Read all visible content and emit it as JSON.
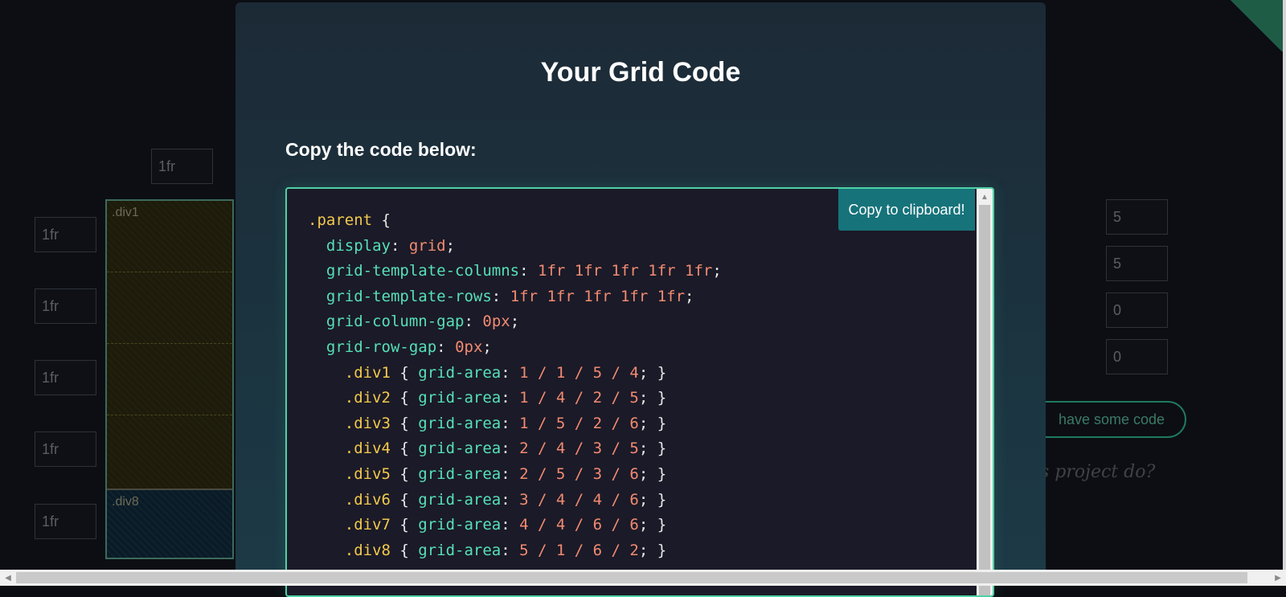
{
  "background": {
    "column_inputs": [
      "1fr"
    ],
    "row_inputs": [
      "1fr",
      "1fr",
      "1fr",
      "1fr",
      "1fr"
    ],
    "settings_inputs": [
      "5",
      "5",
      "0",
      "0"
    ],
    "grid_labels": [
      ".div1",
      ".div8"
    ],
    "code_button_label": "have some code",
    "question_text": "s project do?"
  },
  "modal": {
    "title": "Your Grid Code",
    "subtitle": "Copy the code below:",
    "copy_button_label": "Copy to clipboard!",
    "code_lines": [
      [
        [
          ".parent",
          "sel"
        ],
        [
          " {",
          "punc"
        ]
      ],
      [
        [
          "  ",
          "punc"
        ],
        [
          "display",
          "prop"
        ],
        [
          ": ",
          "punc"
        ],
        [
          "grid",
          "val"
        ],
        [
          ";",
          "punc"
        ]
      ],
      [
        [
          "  ",
          "punc"
        ],
        [
          "grid-template-columns",
          "prop"
        ],
        [
          ": ",
          "punc"
        ],
        [
          "1fr 1fr 1fr 1fr 1fr",
          "val"
        ],
        [
          ";",
          "punc"
        ]
      ],
      [
        [
          "  ",
          "punc"
        ],
        [
          "grid-template-rows",
          "prop"
        ],
        [
          ": ",
          "punc"
        ],
        [
          "1fr 1fr 1fr 1fr 1fr",
          "val"
        ],
        [
          ";",
          "punc"
        ]
      ],
      [
        [
          "  ",
          "punc"
        ],
        [
          "grid-column-gap",
          "prop"
        ],
        [
          ": ",
          "punc"
        ],
        [
          "0px",
          "val"
        ],
        [
          ";",
          "punc"
        ]
      ],
      [
        [
          "  ",
          "punc"
        ],
        [
          "grid-row-gap",
          "prop"
        ],
        [
          ": ",
          "punc"
        ],
        [
          "0px",
          "val"
        ],
        [
          ";",
          "punc"
        ]
      ],
      [
        [
          "    ",
          "punc"
        ],
        [
          ".div1",
          "sel"
        ],
        [
          " { ",
          "punc"
        ],
        [
          "grid-area",
          "prop"
        ],
        [
          ": ",
          "punc"
        ],
        [
          "1 / 1 / 5 / 4",
          "val"
        ],
        [
          "; }",
          "punc"
        ]
      ],
      [
        [
          "    ",
          "punc"
        ],
        [
          ".div2",
          "sel"
        ],
        [
          " { ",
          "punc"
        ],
        [
          "grid-area",
          "prop"
        ],
        [
          ": ",
          "punc"
        ],
        [
          "1 / 4 / 2 / 5",
          "val"
        ],
        [
          "; }",
          "punc"
        ]
      ],
      [
        [
          "    ",
          "punc"
        ],
        [
          ".div3",
          "sel"
        ],
        [
          " { ",
          "punc"
        ],
        [
          "grid-area",
          "prop"
        ],
        [
          ": ",
          "punc"
        ],
        [
          "1 / 5 / 2 / 6",
          "val"
        ],
        [
          "; }",
          "punc"
        ]
      ],
      [
        [
          "    ",
          "punc"
        ],
        [
          ".div4",
          "sel"
        ],
        [
          " { ",
          "punc"
        ],
        [
          "grid-area",
          "prop"
        ],
        [
          ": ",
          "punc"
        ],
        [
          "2 / 4 / 3 / 5",
          "val"
        ],
        [
          "; }",
          "punc"
        ]
      ],
      [
        [
          "    ",
          "punc"
        ],
        [
          ".div5",
          "sel"
        ],
        [
          " { ",
          "punc"
        ],
        [
          "grid-area",
          "prop"
        ],
        [
          ": ",
          "punc"
        ],
        [
          "2 / 5 / 3 / 6",
          "val"
        ],
        [
          "; }",
          "punc"
        ]
      ],
      [
        [
          "    ",
          "punc"
        ],
        [
          ".div6",
          "sel"
        ],
        [
          " { ",
          "punc"
        ],
        [
          "grid-area",
          "prop"
        ],
        [
          ": ",
          "punc"
        ],
        [
          "3 / 4 / 4 / 6",
          "val"
        ],
        [
          "; }",
          "punc"
        ]
      ],
      [
        [
          "    ",
          "punc"
        ],
        [
          ".div7",
          "sel"
        ],
        [
          " { ",
          "punc"
        ],
        [
          "grid-area",
          "prop"
        ],
        [
          ": ",
          "punc"
        ],
        [
          "4 / 4 / 6 / 6",
          "val"
        ],
        [
          "; }",
          "punc"
        ]
      ],
      [
        [
          "    ",
          "punc"
        ],
        [
          ".div8",
          "sel"
        ],
        [
          " { ",
          "punc"
        ],
        [
          "grid-area",
          "prop"
        ],
        [
          ": ",
          "punc"
        ],
        [
          "5 / 1 / 6 / 2",
          "val"
        ],
        [
          "; }",
          "punc"
        ]
      ]
    ]
  },
  "colors": {
    "accent": "#4fd1a5",
    "selector": "#f2c94c",
    "property": "#56e0b6",
    "value": "#f28b71",
    "copy_button": "#16737a"
  }
}
